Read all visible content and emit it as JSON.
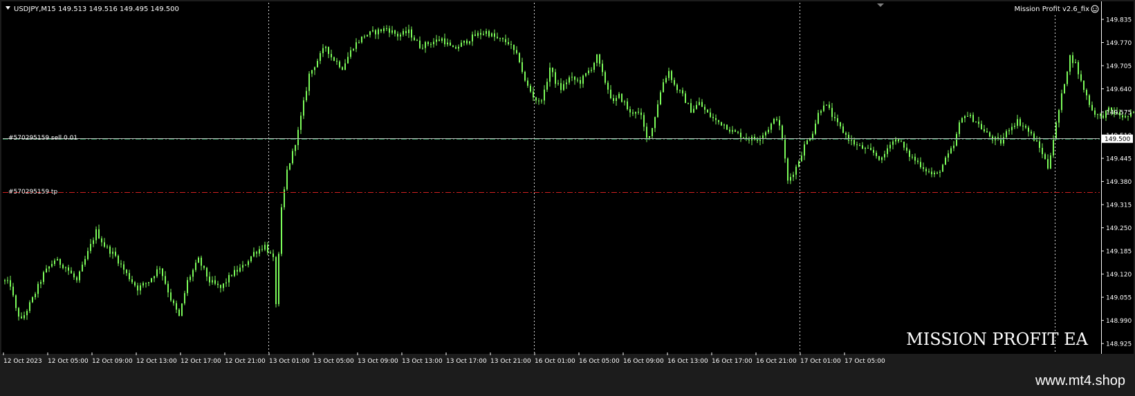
{
  "header": {
    "symbol_info": "USDJPY,M15  149.513 149.516 149.495 149.500",
    "indicator_label": "Mission Profit v2.6_fix",
    "watermark": "MISSION PROFIT EA"
  },
  "footer": {
    "site": "www.mt4.shop"
  },
  "orders": {
    "entry_label": "#570295159 sell 0.01",
    "tp_label": "#570295159 tp"
  },
  "colors": {
    "background": "#000000",
    "frame": "#1c1c1c",
    "candles": "#7cfc5a",
    "grid": "#ffffff",
    "order_line": "#2e8b57",
    "tp_line": "#d22020",
    "axis_text": "#ffffff"
  },
  "chart_data": {
    "type": "candlestick",
    "symbol": "USDJPY",
    "timeframe": "M15",
    "last_price": 149.5,
    "price_axis": {
      "ylim": [
        148.9,
        149.87
      ],
      "ticks": [
        "149.835",
        "149.770",
        "149.705",
        "149.640",
        "149.575",
        "149.510",
        "149.445",
        "149.380",
        "149.315",
        "149.250",
        "149.185",
        "149.120",
        "149.055",
        "148.990",
        "148.925"
      ],
      "current_label": "149.500"
    },
    "time_axis": {
      "labels": [
        "12 Oct 2023",
        "12 Oct 05:00",
        "12 Oct 09:00",
        "12 Oct 13:00",
        "12 Oct 17:00",
        "12 Oct 21:00",
        "13 Oct 01:00",
        "13 Oct 05:00",
        "13 Oct 09:00",
        "13 Oct 13:00",
        "13 Oct 17:00",
        "13 Oct 21:00",
        "16 Oct 01:00",
        "16 Oct 05:00",
        "16 Oct 09:00",
        "16 Oct 13:00",
        "16 Oct 17:00",
        "16 Oct 21:00",
        "17 Oct 01:00",
        "17 Oct 05:00"
      ],
      "bars_per_label": 16
    },
    "orders": [
      {
        "type": "sell",
        "price": 149.5
      },
      {
        "type": "tp",
        "price": 149.35
      }
    ],
    "price_path": [
      [
        0,
        149.1
      ],
      [
        2,
        149.09
      ],
      [
        4,
        149.02
      ],
      [
        6,
        148.99
      ],
      [
        10,
        149.05
      ],
      [
        14,
        149.12
      ],
      [
        18,
        149.16
      ],
      [
        22,
        149.14
      ],
      [
        26,
        149.1
      ],
      [
        30,
        149.18
      ],
      [
        33,
        149.24
      ],
      [
        36,
        149.2
      ],
      [
        40,
        149.17
      ],
      [
        44,
        149.12
      ],
      [
        48,
        149.08
      ],
      [
        52,
        149.1
      ],
      [
        56,
        149.14
      ],
      [
        60,
        149.05
      ],
      [
        63,
        149.0
      ],
      [
        66,
        149.1
      ],
      [
        70,
        149.16
      ],
      [
        74,
        149.1
      ],
      [
        78,
        149.08
      ],
      [
        82,
        149.12
      ],
      [
        86,
        149.14
      ],
      [
        90,
        149.18
      ],
      [
        94,
        149.2
      ],
      [
        97,
        149.16
      ],
      [
        98,
        149.04
      ],
      [
        100,
        149.3
      ],
      [
        102,
        149.41
      ],
      [
        104,
        149.46
      ],
      [
        106,
        149.52
      ],
      [
        108,
        149.6
      ],
      [
        110,
        149.68
      ],
      [
        113,
        149.72
      ],
      [
        116,
        149.76
      ],
      [
        118,
        149.73
      ],
      [
        122,
        149.7
      ],
      [
        126,
        149.76
      ],
      [
        130,
        149.79
      ],
      [
        134,
        149.8
      ],
      [
        138,
        149.81
      ],
      [
        142,
        149.79
      ],
      [
        146,
        149.8
      ],
      [
        150,
        149.76
      ],
      [
        154,
        149.77
      ],
      [
        158,
        149.78
      ],
      [
        162,
        149.75
      ],
      [
        166,
        149.77
      ],
      [
        170,
        149.79
      ],
      [
        174,
        149.8
      ],
      [
        178,
        149.78
      ],
      [
        182,
        149.77
      ],
      [
        186,
        149.72
      ],
      [
        188,
        149.66
      ],
      [
        191,
        149.62
      ],
      [
        193,
        149.6
      ],
      [
        195,
        149.63
      ],
      [
        197,
        149.7
      ],
      [
        199,
        149.66
      ],
      [
        201,
        149.64
      ],
      [
        204,
        149.67
      ],
      [
        208,
        149.66
      ],
      [
        212,
        149.7
      ],
      [
        214,
        149.73
      ],
      [
        216,
        149.68
      ],
      [
        218,
        149.64
      ],
      [
        220,
        149.6
      ],
      [
        222,
        149.62
      ],
      [
        224,
        149.6
      ],
      [
        226,
        149.57
      ],
      [
        228,
        149.58
      ],
      [
        230,
        149.56
      ],
      [
        232,
        149.5
      ],
      [
        234,
        149.53
      ],
      [
        236,
        149.6
      ],
      [
        238,
        149.66
      ],
      [
        240,
        149.69
      ],
      [
        242,
        149.65
      ],
      [
        245,
        149.62
      ],
      [
        248,
        149.58
      ],
      [
        251,
        149.6
      ],
      [
        254,
        149.57
      ],
      [
        257,
        149.55
      ],
      [
        260,
        149.54
      ],
      [
        263,
        149.52
      ],
      [
        266,
        149.51
      ],
      [
        269,
        149.5
      ],
      [
        272,
        149.5
      ],
      [
        275,
        149.52
      ],
      [
        277,
        149.54
      ],
      [
        279,
        149.56
      ],
      [
        281,
        149.5
      ],
      [
        283,
        149.38
      ],
      [
        286,
        149.42
      ],
      [
        289,
        149.48
      ],
      [
        292,
        149.52
      ],
      [
        294,
        149.57
      ],
      [
        296,
        149.6
      ],
      [
        298,
        149.58
      ],
      [
        300,
        149.55
      ],
      [
        302,
        149.53
      ],
      [
        305,
        149.5
      ],
      [
        308,
        149.48
      ],
      [
        311,
        149.47
      ],
      [
        314,
        149.46
      ],
      [
        317,
        149.44
      ],
      [
        320,
        149.49
      ],
      [
        323,
        149.5
      ],
      [
        326,
        149.46
      ],
      [
        329,
        149.44
      ],
      [
        332,
        149.42
      ],
      [
        335,
        149.4
      ],
      [
        337,
        149.4
      ],
      [
        340,
        149.44
      ],
      [
        343,
        149.48
      ],
      [
        345,
        149.54
      ],
      [
        347,
        149.57
      ],
      [
        349,
        149.56
      ],
      [
        351,
        149.55
      ],
      [
        354,
        149.52
      ],
      [
        357,
        149.5
      ],
      [
        360,
        149.49
      ],
      [
        363,
        149.53
      ],
      [
        366,
        149.55
      ],
      [
        369,
        149.53
      ],
      [
        372,
        149.5
      ],
      [
        375,
        149.46
      ],
      [
        377,
        149.42
      ],
      [
        379,
        149.5
      ],
      [
        381,
        149.58
      ],
      [
        383,
        149.66
      ],
      [
        385,
        149.73
      ],
      [
        387,
        149.71
      ],
      [
        389,
        149.66
      ],
      [
        391,
        149.62
      ],
      [
        393,
        149.58
      ],
      [
        396,
        149.56
      ],
      [
        399,
        149.58
      ],
      [
        402,
        149.57
      ],
      [
        405,
        149.56
      ],
      [
        408,
        149.57
      ],
      [
        411,
        149.55
      ],
      [
        414,
        149.54
      ],
      [
        417,
        149.52
      ],
      [
        420,
        149.51
      ],
      [
        423,
        149.52
      ],
      [
        426,
        149.51
      ],
      [
        429,
        149.5
      ],
      [
        432,
        149.5
      ],
      [
        435,
        149.53
      ],
      [
        438,
        149.55
      ],
      [
        441,
        149.56
      ],
      [
        444,
        149.57
      ],
      [
        447,
        149.58
      ],
      [
        449,
        149.56
      ],
      [
        451,
        149.5
      ],
      [
        453,
        149.52
      ],
      [
        456,
        149.54
      ],
      [
        460,
        149.55
      ],
      [
        464,
        149.55
      ],
      [
        468,
        149.53
      ],
      [
        471,
        149.54
      ],
      [
        473,
        149.52
      ],
      [
        475,
        149.5
      ]
    ]
  }
}
